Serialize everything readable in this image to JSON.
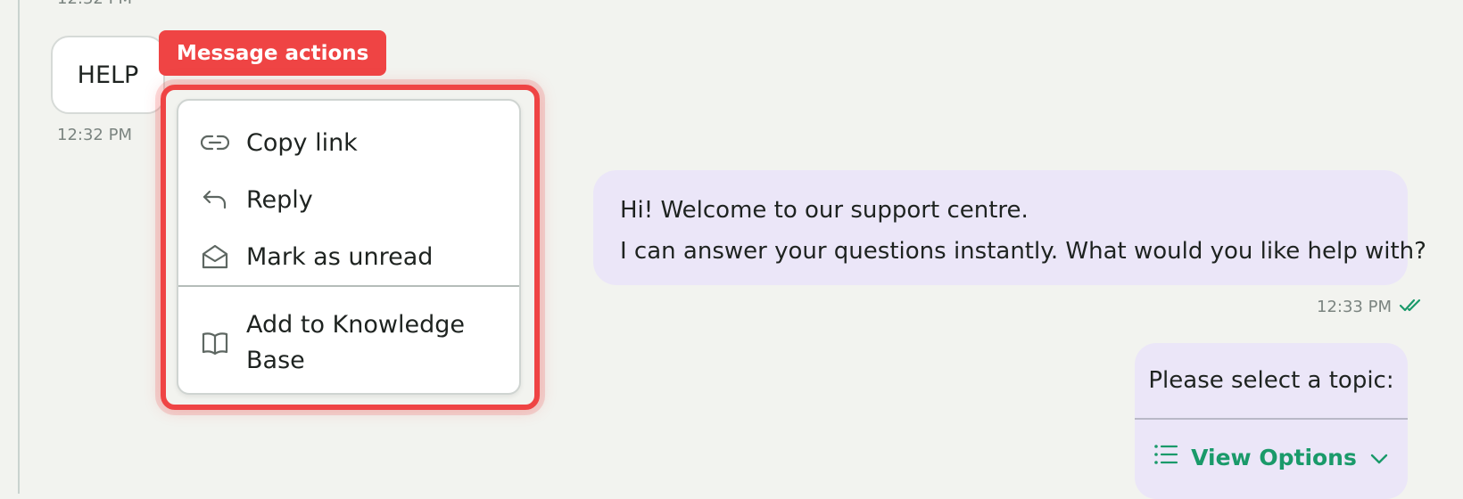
{
  "timestamps": {
    "top": "12:32 PM",
    "help": "12:32 PM",
    "welcome": "12:33 PM"
  },
  "messages": {
    "help": "HELP",
    "welcome_line1": "Hi! Welcome to our support centre.",
    "welcome_line2": "I can answer your questions instantly. What would you like help with?",
    "topic_prompt": "Please select a topic:",
    "view_options": "View Options"
  },
  "annotation": {
    "label": "Message actions",
    "color": "#ef4444"
  },
  "menu": {
    "items": [
      {
        "label": "Copy link",
        "icon": "link-icon"
      },
      {
        "label": "Reply",
        "icon": "reply-icon"
      },
      {
        "label": "Mark as unread",
        "icon": "envelope-open-icon"
      },
      {
        "label": "Add to Knowledge Base",
        "icon": "book-icon"
      }
    ]
  },
  "colors": {
    "accent_green": "#1a9a6a",
    "bubble_purple": "#ebe6f8",
    "background": "#f2f3ef"
  }
}
